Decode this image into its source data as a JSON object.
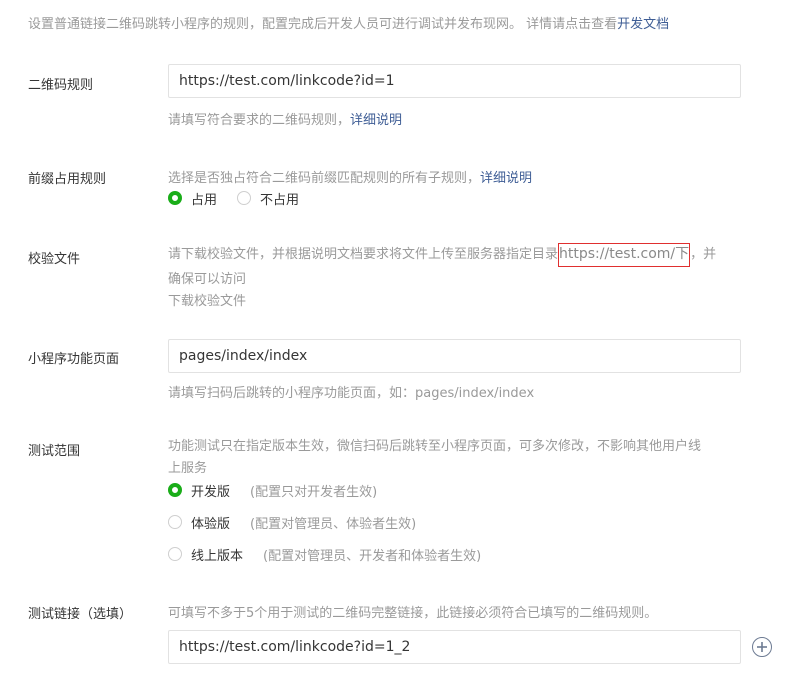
{
  "intro": {
    "text": "设置普通链接二维码跳转小程序的规则，配置完成后开发人员可进行调试并发布现网。 详情请点击查看",
    "link": "开发文档"
  },
  "qr_rule": {
    "label": "二维码规则",
    "value": "https://test.com/linkcode?id=1",
    "hint": "请填写符合要求的二维码规则，",
    "hint_link": "详细说明"
  },
  "prefix_rule": {
    "label": "前缀占用规则",
    "desc": "选择是否独占符合二维码前缀匹配规则的所有子规则，",
    "desc_link": "详细说明",
    "options": [
      {
        "label": "占用",
        "selected": true
      },
      {
        "label": "不占用",
        "selected": false
      }
    ]
  },
  "verify_file": {
    "label": "校验文件",
    "desc_before": "请下载校验文件，并根据说明文档要求将文件上传至服务器指定目录",
    "desc_highlight": "https://test.com/下",
    "desc_after": "，并",
    "desc_line2": "确保可以访问",
    "download_link": "下载校验文件"
  },
  "page": {
    "label": "小程序功能页面",
    "value": "pages/index/index",
    "hint": "请填写扫码后跳转的小程序功能页面，如：pages/index/index"
  },
  "test_scope": {
    "label": "测试范围",
    "desc_line1": "功能测试只在指定版本生效，微信扫码后跳转至小程序页面，可多次修改，不影响其他用户线",
    "desc_line2": "上服务",
    "options": [
      {
        "label": "开发版",
        "note": "(配置只对开发者生效)",
        "selected": true
      },
      {
        "label": "体验版",
        "note": "(配置对管理员、体验者生效)",
        "selected": false
      },
      {
        "label": "线上版本",
        "note": "(配置对管理员、开发者和体验者生效)",
        "selected": false
      }
    ]
  },
  "test_link": {
    "label": "测试链接（选填）",
    "hint": "可填写不多于5个用于测试的二维码完整链接，此链接必须符合已填写的二维码规则。",
    "value": "https://test.com/linkcode?id=1_2",
    "add_icon": "plus-circle-icon"
  },
  "colors": {
    "accent_green": "#1aad19",
    "link_blue": "#3e5d95",
    "highlight_red": "#e02f2f"
  }
}
